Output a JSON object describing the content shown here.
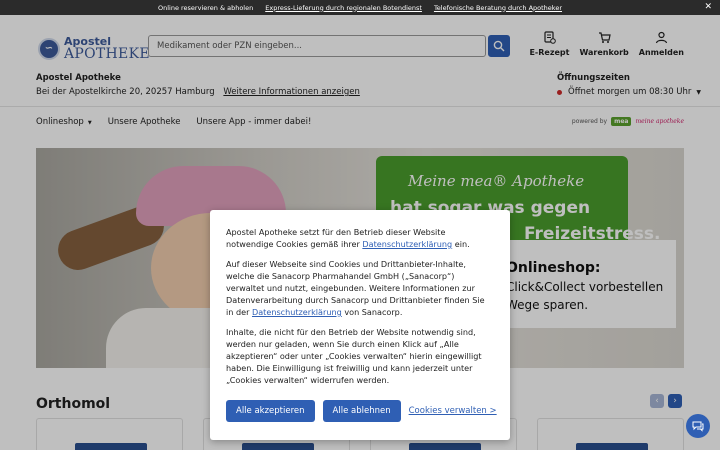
{
  "topbar": {
    "items": [
      "Online reservieren & abholen",
      "Express-Lieferung durch regionalen Botendienst",
      "Telefonische Beratung durch Apotheker"
    ]
  },
  "logo": {
    "line1": "Apostel",
    "line2": "APOTHEKE"
  },
  "search": {
    "placeholder": "Medikament oder PZN eingeben..."
  },
  "header_actions": [
    "E-Rezept",
    "Warenkorb",
    "Anmelden"
  ],
  "store": {
    "name": "Apostel Apotheke",
    "address": "Bei der Apostelkirche 20, 20257 Hamburg",
    "more_link": "Weitere Informationen anzeigen"
  },
  "hours": {
    "title": "Öffnungszeiten",
    "status": "Öffnet morgen um 08:30 Uhr",
    "status_color": "#cc2a2a"
  },
  "nav": {
    "items": [
      "Onlineshop",
      "Unsere Apotheke",
      "Unsere App - immer dabei!"
    ],
    "powered_by": "powered by",
    "mea_badge": "mea",
    "mea_script": "meine apotheke"
  },
  "banner": {
    "green_line1": "Meine mea® Apotheke",
    "green_line2": "hat sogar was gegen",
    "green_line3": "Freizeitstress.",
    "white_line1": "Onlineshop:",
    "white_line2": "Click&Collect vorbestellen",
    "white_line3": "Wege sparen."
  },
  "section": {
    "title": "Orthomol"
  },
  "cookie": {
    "p1_text": "Apostel Apotheke setzt für den Betrieb dieser Website notwendige Cookies gemäß ihrer ",
    "p1_link": "Datenschutzerklärung",
    "p1_end": " ein.",
    "p2_text": "Auf dieser Webseite sind Cookies und Drittanbieter-Inhalte, welche die Sanacorp Pharmahandel GmbH („Sanacorp“) verwaltet und nutzt, eingebunden. Weitere Informationen zur Datenverarbeitung durch Sanacorp und Drittanbieter finden Sie in der ",
    "p2_link": "Datenschutzerklärung",
    "p2_end": " von Sanacorp.",
    "p3_text": "Inhalte, die nicht für den Betrieb der Website notwendig sind, werden nur geladen, wenn Sie durch einen Klick auf „Alle akzeptieren“ oder unter „Cookies verwalten“ hierin eingewilligt haben. Die Einwilligung ist freiwillig und kann jederzeit unter „Cookies verwalten“ widerrufen werden.",
    "accept": "Alle akzeptieren",
    "reject": "Alle ablehnen",
    "manage": "Cookies verwalten >"
  },
  "colors": {
    "primary": "#2f5fb4",
    "brand": "#3c5a9a",
    "mea_green": "#4a9c2c"
  }
}
